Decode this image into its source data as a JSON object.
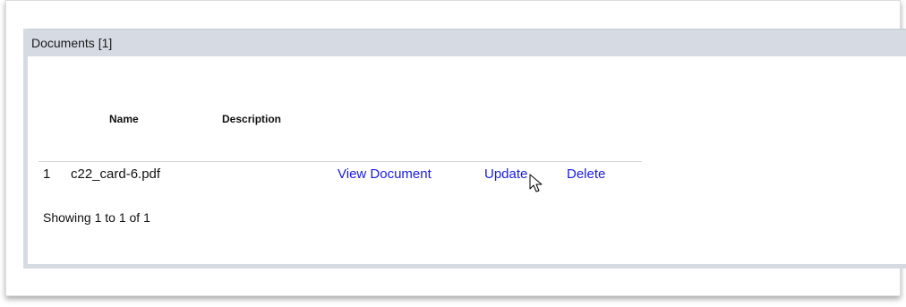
{
  "panel": {
    "title": "Documents [1]"
  },
  "table": {
    "columns": [
      "Name",
      "Description"
    ],
    "rows": [
      {
        "number": "1",
        "name": "c22_card-6.pdf",
        "description": "",
        "actions": {
          "view": "View Document",
          "update": "Update",
          "delete": "Delete"
        }
      }
    ]
  },
  "pagination": {
    "summary": "Showing 1 to 1 of 1"
  },
  "icons": {
    "cursor": "mouse-pointer-icon"
  },
  "colors": {
    "header_bg": "#d6dbe3",
    "link": "#1a1ae6"
  }
}
